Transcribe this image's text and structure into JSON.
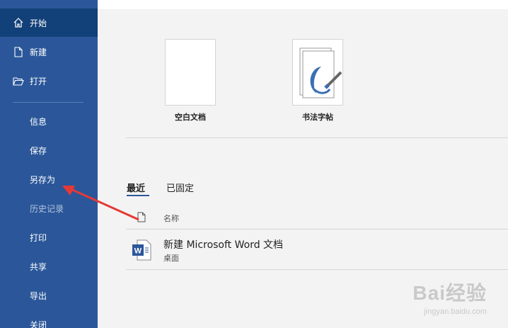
{
  "sidebar": {
    "home": "开始",
    "new": "新建",
    "open": "打开",
    "info": "信息",
    "save": "保存",
    "save_as": "另存为",
    "history": "历史记录",
    "print": "打印",
    "share": "共享",
    "export": "导出",
    "close": "关闭"
  },
  "templates": [
    {
      "label": "空白文档"
    },
    {
      "label": "书法字帖"
    }
  ],
  "recent": {
    "tabs": [
      "最近",
      "已固定"
    ],
    "column_name": "名称",
    "files": [
      {
        "name": "新建 Microsoft Word 文档",
        "location": "桌面"
      }
    ]
  },
  "watermark": {
    "brand": "Bai经验",
    "url": "jingyan.baidu.com"
  },
  "colors": {
    "sidebar": "#2b579a",
    "sidebar_active": "#124078",
    "annotation_arrow": "#e53935"
  }
}
